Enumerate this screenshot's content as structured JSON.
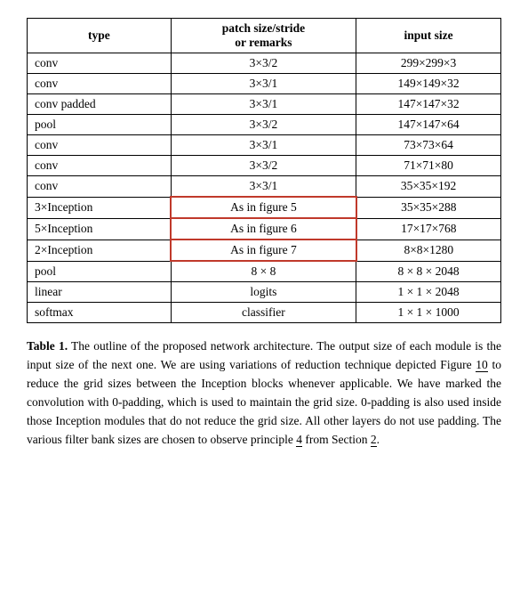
{
  "table": {
    "headers": {
      "type": "type",
      "patch": "patch size/stride",
      "patch_sub": "or remarks",
      "input": "input size"
    },
    "rows": [
      {
        "type": "conv",
        "patch": "3×3/2",
        "input": "299×299×3"
      },
      {
        "type": "conv",
        "patch": "3×3/1",
        "input": "149×149×32"
      },
      {
        "type": "conv padded",
        "patch": "3×3/1",
        "input": "147×147×32"
      },
      {
        "type": "pool",
        "patch": "3×3/2",
        "input": "147×147×64"
      },
      {
        "type": "conv",
        "patch": "3×3/1",
        "input": "73×73×64"
      },
      {
        "type": "conv",
        "patch": "3×3/2",
        "input": "71×71×80"
      },
      {
        "type": "conv",
        "patch": "3×3/1",
        "input": "35×35×192"
      },
      {
        "type": "3×Inception",
        "patch": "As in figure 5",
        "input": "35×35×288",
        "highlight": true
      },
      {
        "type": "5×Inception",
        "patch": "As in figure 6",
        "input": "17×17×768",
        "highlight": true
      },
      {
        "type": "2×Inception",
        "patch": "As in figure 7",
        "input": "8×8×1280",
        "highlight": true
      },
      {
        "type": "pool",
        "patch": "8 × 8",
        "input": "8 × 8 × 2048"
      },
      {
        "type": "linear",
        "patch": "logits",
        "input": "1 × 1 × 2048"
      },
      {
        "type": "softmax",
        "patch": "classifier",
        "input": "1 × 1 × 1000"
      }
    ]
  },
  "caption": {
    "prefix": "Table 1.",
    "text": " The outline of the proposed network architecture.  The output size of each module is the input size of the next one.  We are using variations of reduction technique depicted Figure ",
    "ref_10": "10",
    "text2": " to reduce the grid sizes between the Inception blocks whenever applicable.  We have marked the convolution with 0-padding, which is used to maintain the grid size.  0-padding is also used inside those Inception modules that do not reduce the grid size.  All other layers do not use padding.  The various filter bank sizes are chosen to observe principle ",
    "ref_4": "4",
    "text3": " from Section ",
    "ref_2": "2",
    "text4": "."
  }
}
